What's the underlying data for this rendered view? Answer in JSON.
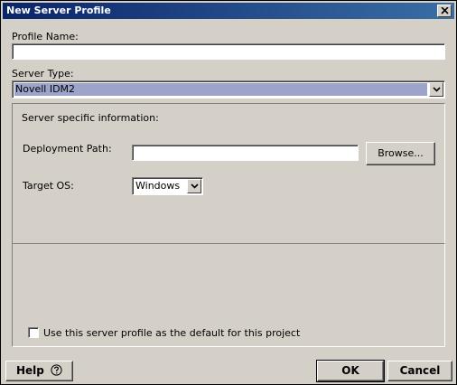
{
  "window": {
    "title": "New Server Profile",
    "close_icon": "close-icon"
  },
  "profile_name": {
    "label": "Profile Name:",
    "value": ""
  },
  "server_type": {
    "label": "Server Type:",
    "selected": "Novell IDM2"
  },
  "server_info": {
    "heading": "Server specific information:",
    "deployment_path_label": "Deployment Path:",
    "deployment_path_value": "",
    "browse_label": "Browse...",
    "target_os_label": "Target OS:",
    "target_os_selected": "Windows"
  },
  "default_checkbox": {
    "label": "Use this server profile as the default for this project",
    "checked": false
  },
  "footer": {
    "help_label": "Help",
    "help_icon": "question-circle-icon",
    "ok_label": "OK",
    "cancel_label": "Cancel"
  },
  "colors": {
    "titlebar_start": "#0a246a",
    "titlebar_end": "#3a6ea5",
    "selection": "#9ca5c9",
    "dialog_bg": "#d4d0c8"
  }
}
